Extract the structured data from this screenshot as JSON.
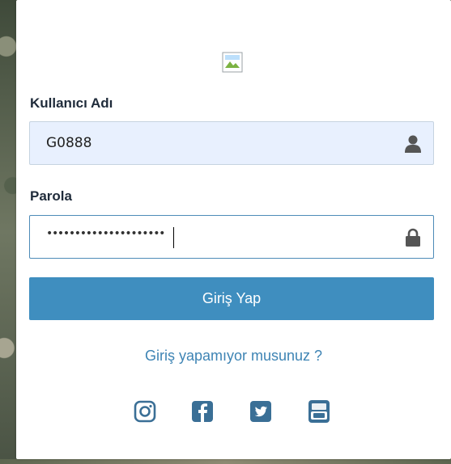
{
  "form": {
    "username_label": "Kullanıcı Adı",
    "username_value": "G0888",
    "password_label": "Parola",
    "password_masked": "•••••••••••••••••••••",
    "login_button": "Giriş Yap",
    "help_link": "Giriş yapamıyor musunuz ?"
  },
  "icons": {
    "username_field": "user-icon",
    "password_field": "lock-icon",
    "logo": "broken-image-icon"
  },
  "social": [
    "instagram-icon",
    "facebook-icon",
    "twitter-icon",
    "youtube-icon"
  ],
  "colors": {
    "accent": "#3f8ebf",
    "link": "#3e84b4",
    "autofill_bg": "#e8f0fe",
    "label": "#1f2b3a"
  }
}
